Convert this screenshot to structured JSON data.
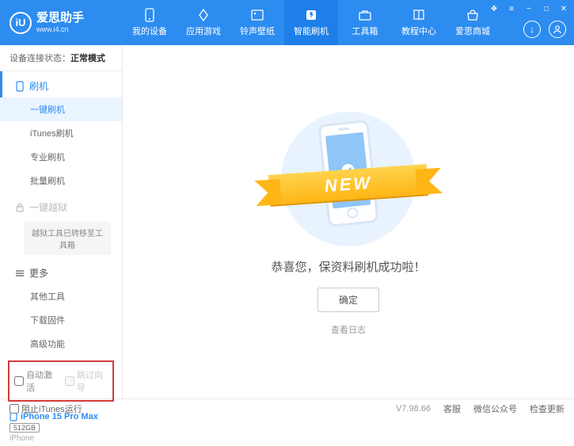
{
  "brand": {
    "name": "爱思助手",
    "url": "www.i4.cn",
    "logo_letter": "iU"
  },
  "nav": [
    {
      "label": "我的设备"
    },
    {
      "label": "应用游戏"
    },
    {
      "label": "铃声壁纸"
    },
    {
      "label": "智能刷机"
    },
    {
      "label": "工具箱"
    },
    {
      "label": "教程中心"
    },
    {
      "label": "爱思商城"
    }
  ],
  "device_status": {
    "label": "设备连接状态：",
    "value": "正常模式"
  },
  "sidebar": {
    "section_flash": "刷机",
    "items_flash": [
      "一键刷机",
      "iTunes刷机",
      "专业刷机",
      "批量刷机"
    ],
    "section_jailbreak": "一键越狱",
    "jailbreak_note": "越狱工具已转移至工具箱",
    "section_more": "更多",
    "items_more": [
      "其他工具",
      "下载固件",
      "高级功能"
    ]
  },
  "options": {
    "auto_activate": "自动激活",
    "skip_guide": "跳过向导"
  },
  "device": {
    "name": "iPhone 15 Pro Max",
    "storage": "512GB",
    "type": "iPhone"
  },
  "main": {
    "ribbon": "NEW",
    "success": "恭喜您，保资料刷机成功啦！",
    "ok": "确定",
    "view_log": "查看日志"
  },
  "footer": {
    "block_itunes": "阻止iTunes运行",
    "version": "V7.98.66",
    "links": [
      "客服",
      "微信公众号",
      "检查更新"
    ]
  }
}
